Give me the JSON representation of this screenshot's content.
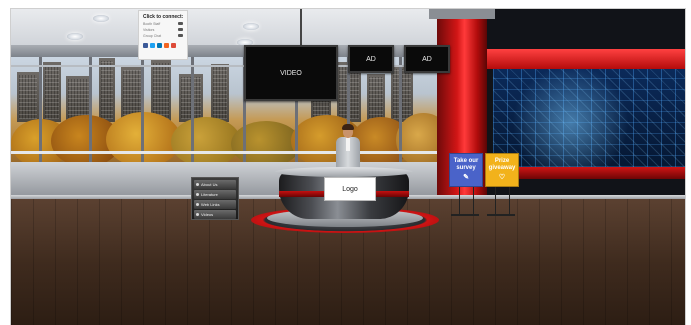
{
  "contact_panel": {
    "title": "Click to connect:",
    "rows": [
      {
        "label": "Booth Staff",
        "icon": "chat-icon"
      },
      {
        "label": "Visitors",
        "icon": "chat-icon"
      },
      {
        "label": "Group Chat",
        "icon": "group-chat-icon"
      }
    ],
    "social": [
      {
        "name": "facebook-icon",
        "color": "#3b5998"
      },
      {
        "name": "twitter-icon",
        "color": "#1da1f2"
      },
      {
        "name": "linkedin-icon",
        "color": "#0077b5"
      },
      {
        "name": "rss-icon",
        "color": "#f26522"
      },
      {
        "name": "googleplus-icon",
        "color": "#dd4b39"
      }
    ]
  },
  "screens": {
    "video": "VIDEO",
    "ad_left": "AD",
    "ad_right": "AD"
  },
  "menu": {
    "items": [
      {
        "label": "About Us"
      },
      {
        "label": "Literature"
      },
      {
        "label": "Web Links"
      },
      {
        "label": "Videos"
      }
    ]
  },
  "desk": {
    "logo": "Logo"
  },
  "signs": {
    "survey": {
      "line1": "Take our",
      "line2": "survey",
      "glyph": "✎",
      "color": "#4a63c9"
    },
    "prize": {
      "line1": "Prize",
      "line2": "giveaway",
      "glyph": "♡",
      "color": "#f2b21b"
    }
  },
  "colors": {
    "pillar_red": "#d11616",
    "circuit_blue": "#0b2a5a"
  }
}
